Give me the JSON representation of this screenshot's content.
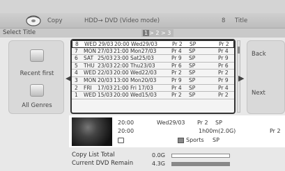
{
  "header": {
    "mode": "Copy",
    "path": "HDD→ DVD (Video mode)",
    "title_count": "8",
    "title_word": "Title"
  },
  "subbar": {
    "select_title": "Select Title",
    "pager_current": "1",
    "pager_rest": "> 2 > 3"
  },
  "left_panel": {
    "recent_first": "Recent first",
    "all_genres": "All Genres"
  },
  "right_panel": {
    "back": "Back",
    "next": "Next"
  },
  "list_rows": [
    {
      "num": "8",
      "day": "WED",
      "date": "29/03",
      "time": "20:00",
      "name": "Wed29/03",
      "ch": "Pr 2",
      "mode": "SP",
      "ch2": "Pr 2"
    },
    {
      "num": "7",
      "day": "MON",
      "date": "27/03",
      "time": "21:00",
      "name": "Mon27/03",
      "ch": "Pr 4",
      "mode": "SP",
      "ch2": "Pr 4"
    },
    {
      "num": "6",
      "day": "SAT",
      "date": "25/03",
      "time": "23:00",
      "name": "Sat25/03",
      "ch": "Pr 9",
      "mode": "SP",
      "ch2": "Pr 9"
    },
    {
      "num": "5",
      "day": "THU",
      "date": "23/03",
      "time": "22:00",
      "name": "Thu23/03",
      "ch": "Pr 6",
      "mode": "SP",
      "ch2": "Pr 6"
    },
    {
      "num": "4",
      "day": "WED",
      "date": "22/03",
      "time": "20:00",
      "name": "Wed22/03",
      "ch": "Pr 2",
      "mode": "SP",
      "ch2": "Pr 2"
    },
    {
      "num": "3",
      "day": "MON",
      "date": "20/03",
      "time": "13:00",
      "name": "Mon20/03",
      "ch": "Pr 9",
      "mode": "SP",
      "ch2": "Pr 9"
    },
    {
      "num": "2",
      "day": "FRI",
      "date": "17/03",
      "time": "21:00",
      "name": "Fri 17/03",
      "ch": "Pr 4",
      "mode": "SP",
      "ch2": "Pr 4"
    },
    {
      "num": "1",
      "day": "WED",
      "date": "15/03",
      "time": "20:00",
      "name": "Wed15/03",
      "ch": "Pr 2",
      "mode": "SP",
      "ch2": "Pr 2"
    }
  ],
  "selected_row": 0,
  "info": {
    "start_time": "20:00",
    "end_time": "20:00",
    "title": "Wed29/03",
    "channel": "Pr 2",
    "mode": "SP",
    "duration": "1h00m(2.0G)",
    "genre": "Sports",
    "genre_mode": "SP",
    "channel_right": "Pr 2"
  },
  "bottom": {
    "copy_list_total_label": "Copy List Total",
    "copy_list_total_value": "0.0G",
    "copy_list_total_fraction": 0.0,
    "dvd_remain_label": "Current DVD Remain",
    "dvd_remain_value": "4.3G",
    "dvd_remain_fraction": 1.0
  },
  "colors": {
    "background": "#e8e8e8",
    "header_bar": "#c8c8c8",
    "selected_border": "#222222"
  }
}
